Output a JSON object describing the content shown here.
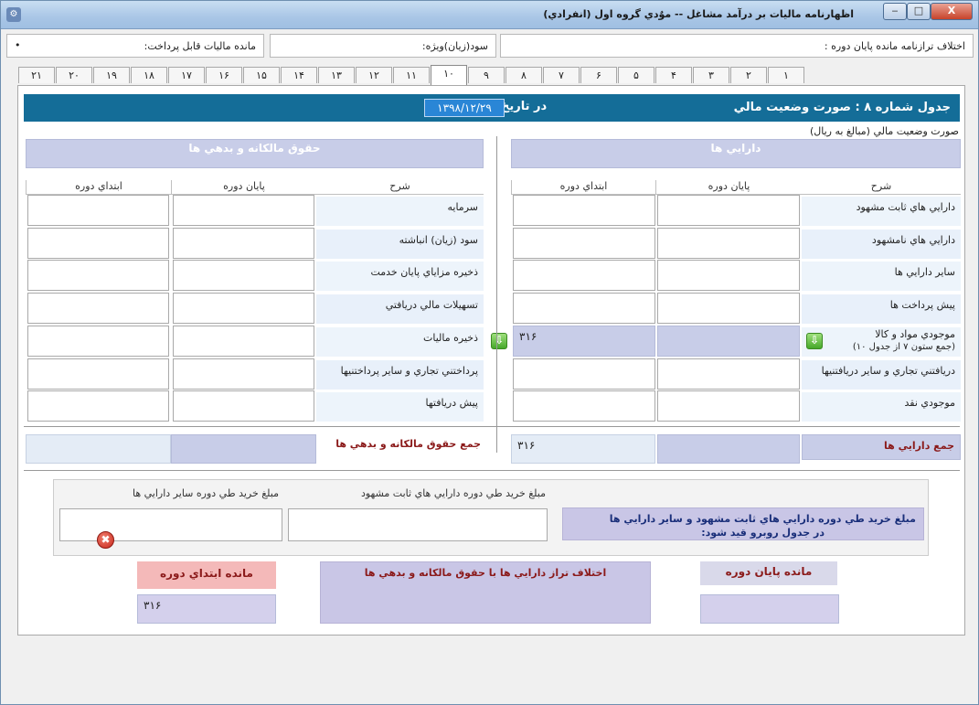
{
  "window": {
    "title": "اظهارنامه ماليات بر درآمد مشاغل -- موٌدي گروه اول (انفرادي)",
    "min_label": "‒",
    "max_label": "□",
    "close_label": "X"
  },
  "info": {
    "tax_payable_label": "مانده ماليات قابل پرداخت:",
    "tax_payable_value": "•",
    "special_profit_label": "سود(زيان)ويژه:",
    "balance_diff_label": "اختلاف ترازنامه مانده پايان دوره :"
  },
  "tabs": [
    "١",
    "٢",
    "٣",
    "۴",
    "۵",
    "۶",
    "٧",
    "٨",
    "٩",
    "١٠",
    "١١",
    "١٢",
    "١٣",
    "١۴",
    "١۵",
    "١۶",
    "١٧",
    "١٨",
    "١٩",
    "٢٠",
    "٢١"
  ],
  "active_tab": "١٠",
  "header": {
    "title": "جدول شماره ٨ : صورت وضعيت مالي",
    "date_label": "در تاريخ",
    "date_value": "١٣٩٨/١٢/٢٩"
  },
  "assets": {
    "subtitle": "صورت وضعيت مالي (مبالغ به ريال)",
    "heading": "دارايي ها",
    "col_desc": "شرح",
    "col_end": "پايان دوره",
    "col_start": "ابتداي دوره",
    "rows": [
      {
        "label": "دارايي هاي ثابت مشهود",
        "end": "",
        "start": ""
      },
      {
        "label": "دارايي هاي نامشهود",
        "end": "",
        "start": ""
      },
      {
        "label": "ساير دارايي ها",
        "end": "",
        "start": ""
      },
      {
        "label": "پيش پرداخت ها",
        "end": "",
        "start": ""
      },
      {
        "label": "موجودي مواد و كالا",
        "sublabel": "(جمع ستون ٧ از جدول ١٠)",
        "end": "",
        "start": "٣١۶"
      },
      {
        "label": "دريافتني تجاري و ساير دريافتنيها",
        "end": "",
        "start": ""
      },
      {
        "label": "موجودي نقد",
        "end": "",
        "start": ""
      }
    ],
    "total_label": "جمع دارايي ها",
    "total_end": "",
    "total_start": "٣١۶"
  },
  "liabilities": {
    "heading": "حقوق مالكانه و بدهي ها",
    "col_desc": "شرح",
    "col_end": "پايان دوره",
    "col_start": "ابتداي دوره",
    "rows": [
      {
        "label": "سرمايه",
        "end": "",
        "start": ""
      },
      {
        "label": "سود (زيان) انباشته",
        "end": "",
        "start": ""
      },
      {
        "label": "ذخيره مزاياي پايان خدمت",
        "end": "",
        "start": ""
      },
      {
        "label": "تسهيلات مالي دريافتي",
        "end": "",
        "start": ""
      },
      {
        "label": "ذخيره ماليات",
        "end": "",
        "start": ""
      },
      {
        "label": "پرداختني تجاري و ساير پرداختنيها",
        "end": "",
        "start": ""
      },
      {
        "label": "پيش دريافتها",
        "end": "",
        "start": ""
      }
    ],
    "total_label": "جمع حقوق مالكانه و بدهي ها",
    "total_end": "",
    "total_start": ""
  },
  "purchases": {
    "instruction_line1": "مبلغ خريد طي دوره دارايي هاي ثابت مشهود و ساير دارايي ها",
    "instruction_line2": "در جدول روبرو قيد شود:",
    "fixed_assets_label": "مبلغ خريد طي دوره دارايي هاي ثابت مشهود",
    "fixed_assets_value": "",
    "other_assets_label": "مبلغ خريد طي دوره ساير دارايي ها",
    "other_assets_value": ""
  },
  "balance": {
    "end_label": "مانده پايان دوره",
    "end_value": "",
    "diff_label": "اختلاف تراز دارايي ها با حقوق مالكانه و بدهي ها",
    "start_label": "مانده ابتداي دوره",
    "start_value": "٣١۶"
  },
  "icons": {
    "down_arrow": "⇩",
    "error": "✖"
  },
  "colors": {
    "header_blue": "#146d98",
    "section_lavender": "#c8cde8",
    "total_red": "#8b1a1a",
    "start_balance_pink": "#f4b9b9"
  }
}
